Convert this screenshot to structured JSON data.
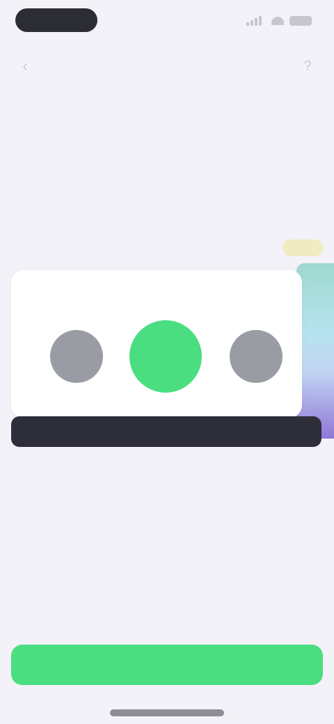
{
  "status_bar": {
    "time": "",
    "icons": [
      "signal-icon",
      "wifi-icon",
      "battery-icon"
    ]
  },
  "nav": {
    "back_icon": "back-arrow-icon",
    "title": "",
    "help_icon": "help-icon"
  },
  "section": {
    "label": "",
    "tag": ""
  },
  "selection": {
    "participants": [
      {
        "name": "",
        "state": "inactive"
      },
      {
        "name": "",
        "state": "selected"
      },
      {
        "name": "",
        "state": "inactive"
      }
    ],
    "selected_mark": ""
  },
  "banner": {
    "text": ""
  },
  "caption": "",
  "action_button": {
    "label": ""
  },
  "colors": {
    "background": "#f3f2f8",
    "accent": "#4ade80",
    "dark_bar": "#2d2e3a",
    "avatar_gray": "#9a9ca3",
    "tag_yellow": "#f0ecc2",
    "swatch_top": "#9ed8cf",
    "swatch_bottom": "#8f77d8"
  }
}
